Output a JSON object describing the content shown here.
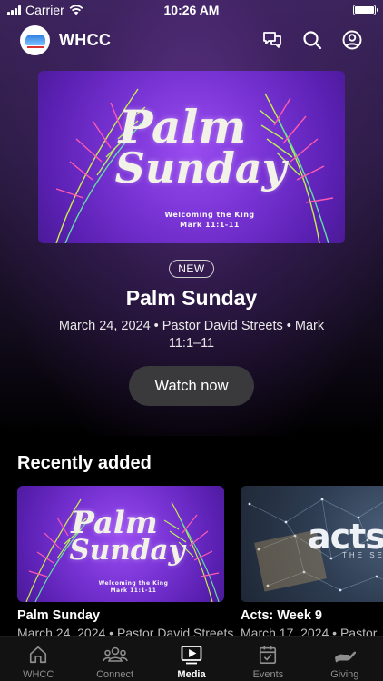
{
  "status_bar": {
    "carrier": "Carrier",
    "time": "10:26 AM"
  },
  "header": {
    "title": "WHCC",
    "icons": [
      "chat-icon",
      "search-icon",
      "profile-icon"
    ]
  },
  "featured": {
    "art_title_line1": "Palm",
    "art_title_line2": "Sunday",
    "art_subtitle_line1": "Welcoming the King",
    "art_subtitle_line2": "Mark 11:1-11",
    "badge": "NEW",
    "title": "Palm Sunday",
    "meta": "March 24, 2024 • Pastor David Streets • Mark 11:1–11",
    "watch_label": "Watch now"
  },
  "recently_added": {
    "title": "Recently added",
    "items": [
      {
        "title": "Palm Sunday",
        "meta": "March 24, 2024 • Pastor David Streets",
        "art_title_line1": "Palm",
        "art_title_line2": "Sunday",
        "art_subtitle_line1": "Welcoming the King",
        "art_subtitle_line2": "Mark 11:1-11"
      },
      {
        "title": "Acts: Week 9",
        "meta": "March 17, 2024 • Pastor",
        "art_word": "acts",
        "art_sub": "THE SERIES"
      }
    ]
  },
  "tab_bar": {
    "tabs": [
      {
        "label": "WHCC",
        "icon": "home-icon",
        "active": false
      },
      {
        "label": "Connect",
        "icon": "people-icon",
        "active": false
      },
      {
        "label": "Media",
        "icon": "media-icon",
        "active": true
      },
      {
        "label": "Events",
        "icon": "calendar-icon",
        "active": false
      },
      {
        "label": "Giving",
        "icon": "giving-icon",
        "active": false
      }
    ]
  },
  "colors": {
    "accent_purple": "#7a34d6",
    "button_bg": "#3a3a3c",
    "tab_bar_bg": "#121212"
  }
}
